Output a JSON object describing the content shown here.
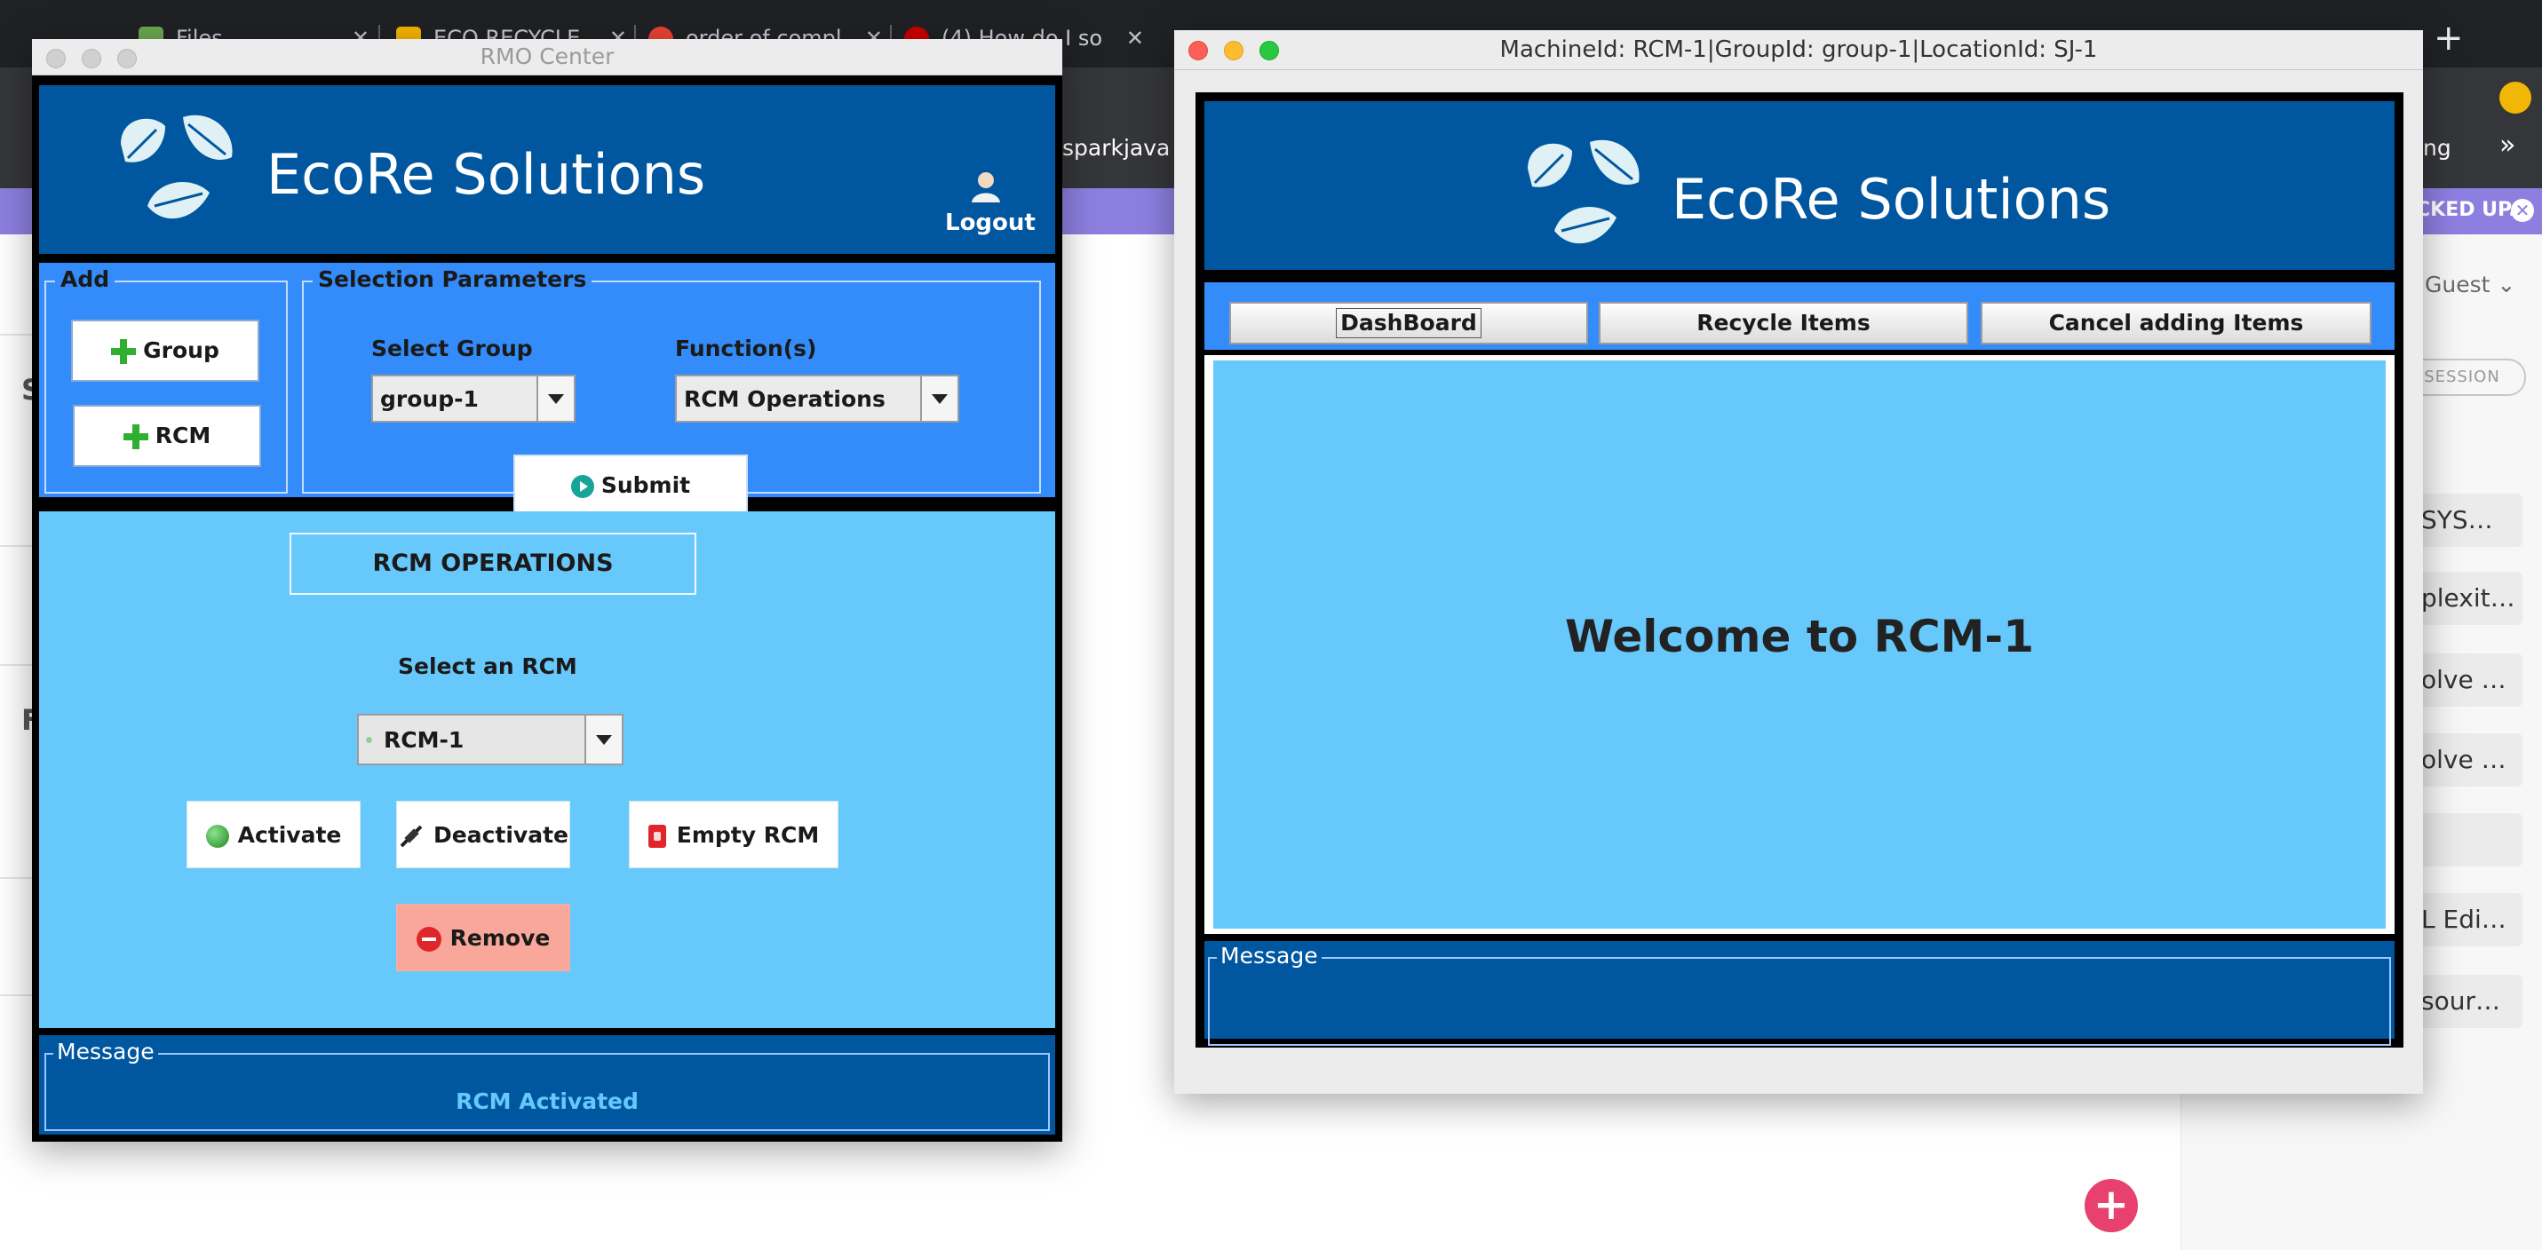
{
  "browser": {
    "tabs": [
      {
        "label": "Files",
        "favicon_color": "#6aa84f"
      },
      {
        "label": "ECO RECYCLE",
        "favicon_color": "#f4b400"
      },
      {
        "label": "order of compl",
        "favicon_color": "#ea4335"
      },
      {
        "label": "(4) How do I so",
        "favicon_color": "#cc0000"
      }
    ],
    "bookmark_sparkjava": "sparkjava",
    "bookmark_ng": "ng",
    "bookmark_more": "»",
    "banner_text": "CKED UP.",
    "banner_close": "✕",
    "guest_label": "Guest",
    "guest_chevron": "⌄",
    "session_pill": "SESSION",
    "side_items": [
      "SYS…",
      "plexit…",
      "olve …",
      "olve …",
      "",
      "L Edi…",
      "sour…"
    ],
    "page_letters": [
      "S",
      "F"
    ],
    "fab_label": "+"
  },
  "rmo_window": {
    "title": "RMO Center",
    "brand": "EcoRe Solutions",
    "logout_label": "Logout",
    "add_group": {
      "legend": "Add",
      "group_button": "Group",
      "rcm_button": "RCM"
    },
    "selection": {
      "legend": "Selection Parameters",
      "group_label": "Select Group",
      "group_value": "group-1",
      "function_label": "Function(s)",
      "function_value": "RCM Operations",
      "submit_label": "Submit"
    },
    "operations": {
      "title": "RCM OPERATIONS",
      "select_label": "Select an RCM",
      "selected_rcm": "RCM-1",
      "activate_label": "Activate",
      "deactivate_label": "Deactivate",
      "empty_label": "Empty RCM",
      "remove_label": "Remove"
    },
    "message": {
      "legend": "Message",
      "text": "RCM Activated"
    }
  },
  "machine_window": {
    "title": "MachineId: RCM-1|GroupId: group-1|LocationId: SJ-1",
    "brand": "EcoRe Solutions",
    "nav": {
      "dashboard_label": "DashBoard",
      "recycle_label": "Recycle Items",
      "cancel_label": "Cancel adding Items"
    },
    "welcome_text": "Welcome to RCM-1",
    "message": {
      "legend": "Message",
      "text": ""
    }
  },
  "colors": {
    "header_blue": "#0057a0",
    "band_blue": "#338cfa",
    "light_blue": "#66c8fb",
    "remove_pink": "#f9a79a",
    "message_text": "#66c8fb"
  }
}
